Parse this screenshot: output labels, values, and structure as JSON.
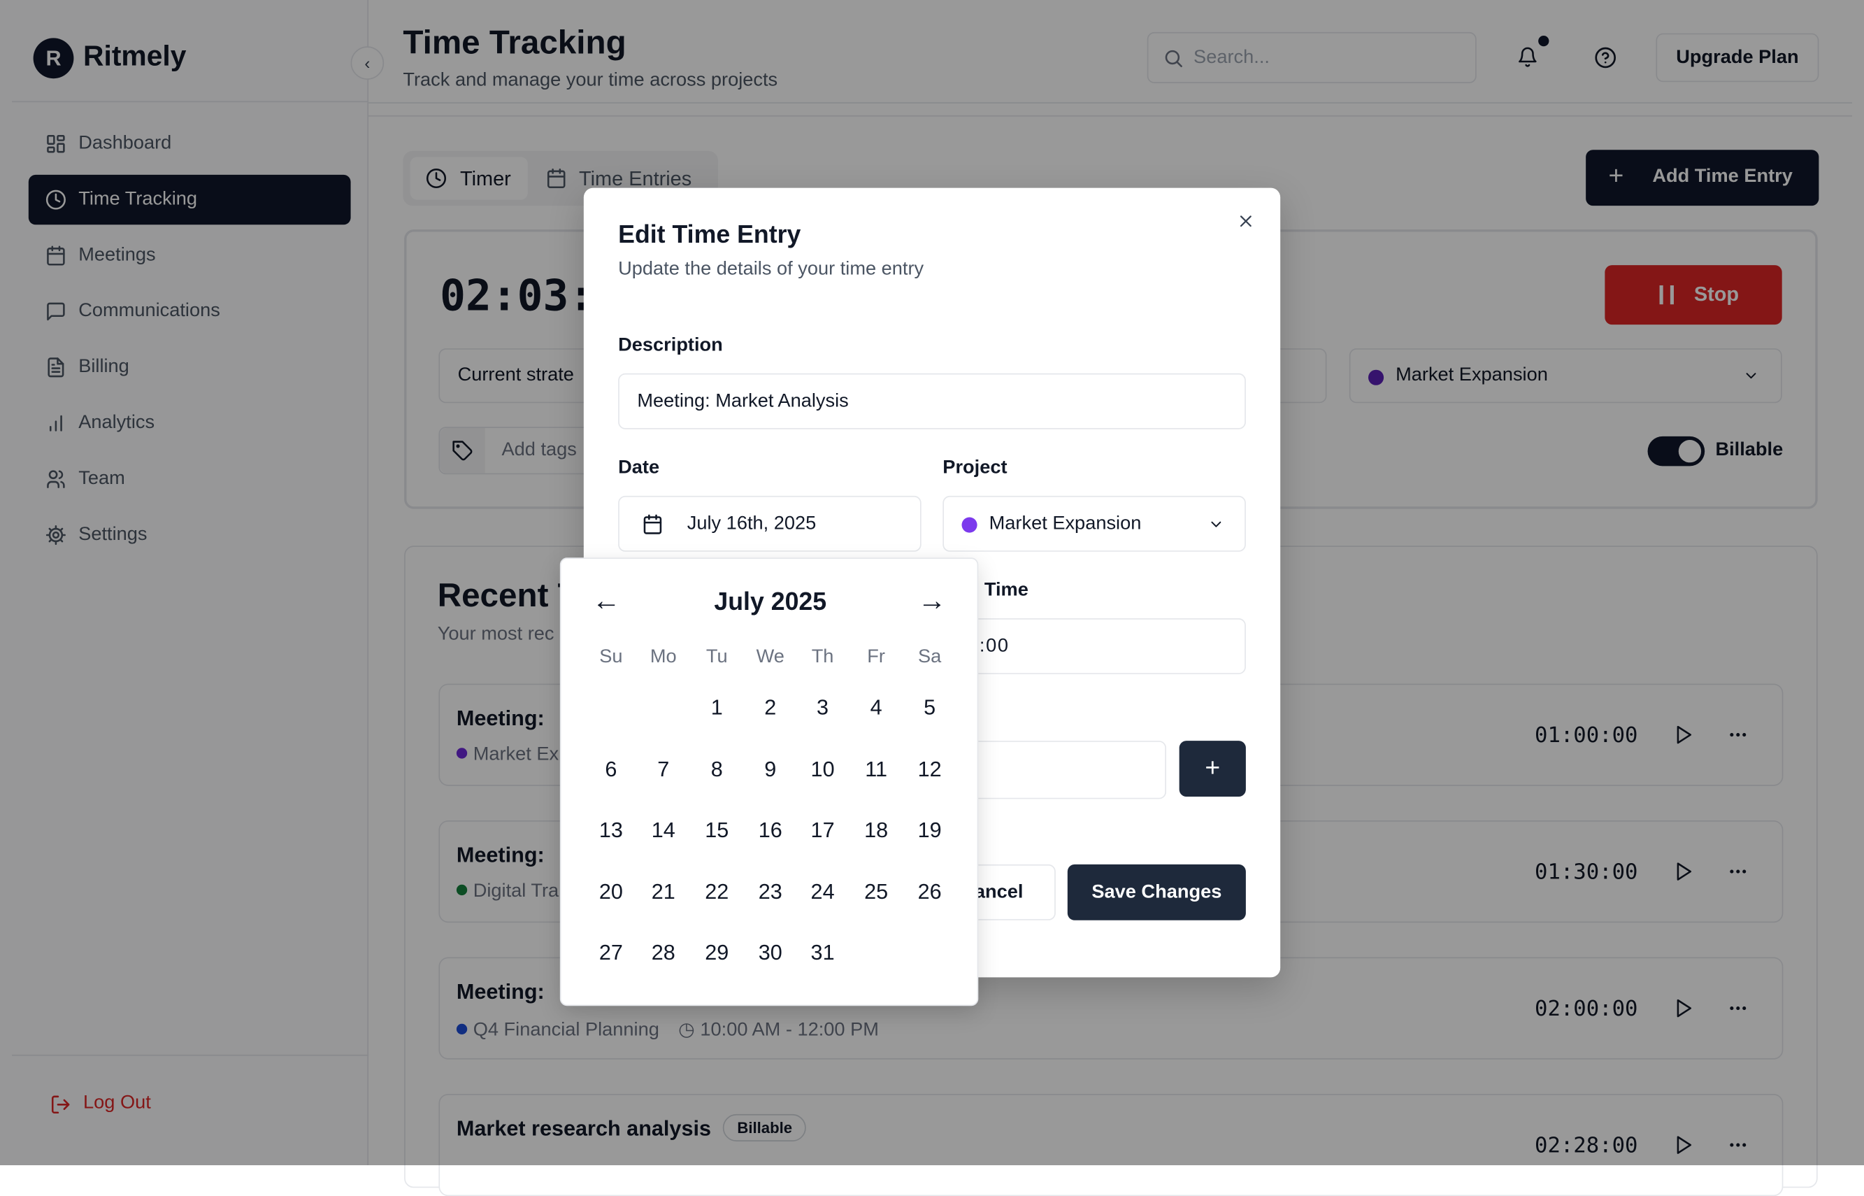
{
  "app": {
    "name": "Ritmely",
    "logo_letter": "R"
  },
  "sidebar": {
    "items": [
      {
        "label": "Dashboard",
        "icon": "dashboard-icon"
      },
      {
        "label": "Time Tracking",
        "icon": "clock-icon",
        "active": true
      },
      {
        "label": "Meetings",
        "icon": "calendar-icon"
      },
      {
        "label": "Communications",
        "icon": "message-icon"
      },
      {
        "label": "Billing",
        "icon": "file-icon"
      },
      {
        "label": "Analytics",
        "icon": "bar-chart-icon"
      },
      {
        "label": "Team",
        "icon": "users-icon"
      },
      {
        "label": "Settings",
        "icon": "gear-icon"
      }
    ],
    "logout": "Log Out"
  },
  "header": {
    "title": "Time Tracking",
    "subtitle": "Track and manage your time across projects",
    "search_placeholder": "Search...",
    "upgrade": "Upgrade Plan",
    "notification_dot": true
  },
  "tabs": [
    {
      "label": "Timer",
      "active": true
    },
    {
      "label": "Time Entries"
    }
  ],
  "add_entry": "Add Time Entry",
  "timer": {
    "display": "02:03:",
    "stop": "Stop",
    "description": "Current strate",
    "project": "Market Expansion",
    "project_color": "#5b21b6",
    "tags_placeholder": "Add tags",
    "billable_label": "Billable",
    "billable": true
  },
  "recent": {
    "title": "Recent T",
    "subtitle": "Your most rec",
    "entries": [
      {
        "title": "Meeting: ",
        "project": "Market Ex",
        "color": "#6d28d9",
        "duration": "01:00:00"
      },
      {
        "title": "Meeting: ",
        "project": "Digital Tra",
        "color": "#15803d",
        "duration": "01:30:00"
      },
      {
        "title": "Meeting: ",
        "project": "Q4 Financial Planning",
        "color": "#1d4ed8",
        "time": "10:00 AM - 12:00 PM",
        "duration": "02:00:00"
      },
      {
        "title": "Market research analysis",
        "badge": "Billable",
        "duration": "02:28:00"
      }
    ]
  },
  "modal": {
    "title": "Edit Time Entry",
    "subtitle": "Update the details of your time entry",
    "description_label": "Description",
    "description": "Meeting: Market Analysis",
    "date_label": "Date",
    "date": "July 16th, 2025",
    "project_label": "Project",
    "project": "Market Expansion",
    "project_color": "#7c3aed",
    "time_label": "Time",
    "time_value": "7:00",
    "cancel": "Cancel",
    "save": "Save Changes"
  },
  "calendar": {
    "month": "July 2025",
    "weekdays": [
      "Su",
      "Mo",
      "Tu",
      "We",
      "Th",
      "Fr",
      "Sa"
    ],
    "first_weekday": 2,
    "days": 31
  }
}
